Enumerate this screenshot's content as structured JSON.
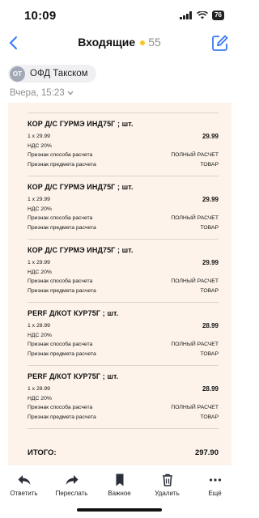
{
  "status": {
    "time": "10:09",
    "battery": "76"
  },
  "nav": {
    "title": "Входящие",
    "count": "55"
  },
  "sender": {
    "initials": "ОТ",
    "name": "ОФД Такском"
  },
  "date": "Вчера, 15:23",
  "receipt": {
    "items": [
      {
        "name": "КОР Д/С ГУРМЭ ИНД75Г ; шт.",
        "qty": "1 x 29.99",
        "price": "29.99",
        "vat": "НДС 20%",
        "method_label": "Признак способа расчета",
        "method_value": "ПОЛНЫЙ РАСЧЕТ",
        "subject_label": "Признак предмета расчета",
        "subject_value": "ТОВАР"
      },
      {
        "name": "КОР Д/С ГУРМЭ ИНД75Г ; шт.",
        "qty": "1 x 29.99",
        "price": "29.99",
        "vat": "НДС 20%",
        "method_label": "Признак способа расчета",
        "method_value": "ПОЛНЫЙ РАСЧЕТ",
        "subject_label": "Признак предмета расчета",
        "subject_value": "ТОВАР"
      },
      {
        "name": "КОР Д/С ГУРМЭ ИНД75Г ; шт.",
        "qty": "1 x 29.99",
        "price": "29.99",
        "vat": "НДС 20%",
        "method_label": "Признак способа расчета",
        "method_value": "ПОЛНЫЙ РАСЧЕТ",
        "subject_label": "Признак предмета расчета",
        "subject_value": "ТОВАР"
      },
      {
        "name": "PERF Д/КОТ КУР75Г ; шт.",
        "qty": "1 x 28.99",
        "price": "28.99",
        "vat": "НДС 20%",
        "method_label": "Признак способа расчета",
        "method_value": "ПОЛНЫЙ РАСЧЕТ",
        "subject_label": "Признак предмета расчета",
        "subject_value": "ТОВАР"
      },
      {
        "name": "PERF Д/КОТ КУР75Г ; шт.",
        "qty": "1 x 28.99",
        "price": "28.99",
        "vat": "НДС 20%",
        "method_label": "Признак способа расчета",
        "method_value": "ПОЛНЫЙ РАСЧЕТ",
        "subject_label": "Признак предмета расчета",
        "subject_value": "ТОВАР"
      }
    ],
    "total_label": "ИТОГО:",
    "total_value": "297.90"
  },
  "toolbar": {
    "reply": "Ответить",
    "forward": "Переслать",
    "important": "Важное",
    "delete": "Удалить",
    "more": "Ещё"
  },
  "colors": {
    "accent": "#3478f6",
    "receipt_bg": "#fdf3eb",
    "unread_dot": "#f7c624"
  }
}
